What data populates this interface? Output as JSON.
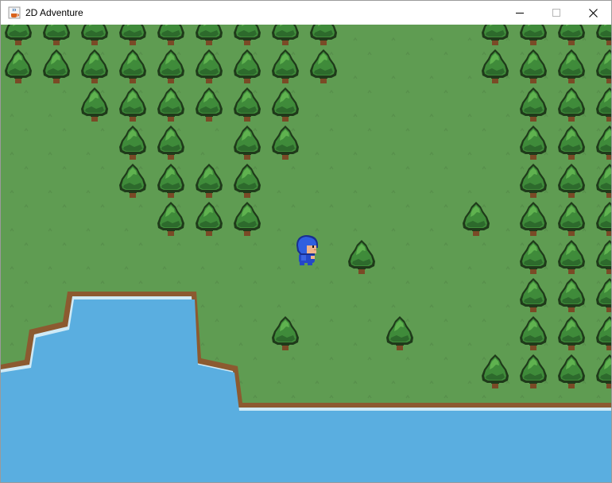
{
  "window": {
    "title": "2D Adventure",
    "icon": "java-cup-icon",
    "controls": [
      "minimize-icon",
      "maximize-icon",
      "close-icon"
    ]
  },
  "scene": {
    "colors": {
      "grass": "#5f9c52",
      "water": "#5aaee0",
      "foam": "#cfeaf6",
      "dirt": "#8c5a30",
      "tree_outline": "#1f3a1a",
      "tree_dark": "#2f6d2e",
      "tree_light": "#4a9a42",
      "trunk": "#7a4a26",
      "hero_hair": "#2448c8",
      "hero_skin": "#f2b48a"
    }
  }
}
